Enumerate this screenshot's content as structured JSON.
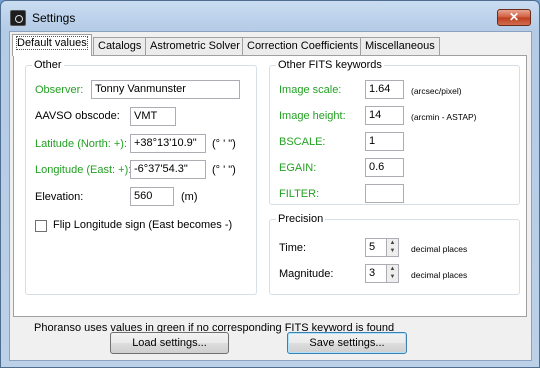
{
  "window": {
    "title": "Settings",
    "close_glyph": "✕"
  },
  "tabs": [
    "Default values",
    "Catalogs",
    "Astrometric Solver",
    "Correction Coefficients",
    "Miscellaneous"
  ],
  "other": {
    "legend": "Other",
    "observer_label": "Observer:",
    "observer_value": "Tonny Vanmunster",
    "obscode_label": "AAVSO obscode:",
    "obscode_value": "VMT",
    "lat_label": "Latitude (North: +):",
    "lat_value": "+38°13'10.9\"",
    "lat_unit": "(° ' \")",
    "lon_label": "Longitude (East: +):",
    "lon_value": "-6°37'54.3\"",
    "lon_unit": "(° ' \")",
    "elev_label": "Elevation:",
    "elev_value": "560",
    "elev_unit": "(m)",
    "flip_label": "Flip Longitude sign (East becomes -)",
    "flip_checked": false
  },
  "fits": {
    "legend": "Other FITS keywords",
    "scale_label": "Image scale:",
    "scale_value": "1.64",
    "scale_unit": "(arcsec/pixel)",
    "height_label": "Image height:",
    "height_value": "14",
    "height_unit": "(arcmin - ASTAP)",
    "bscale_label": "BSCALE:",
    "bscale_value": "1",
    "egain_label": "EGAIN:",
    "egain_value": "0.6",
    "filter_label": "FILTER:",
    "filter_value": ""
  },
  "precision": {
    "legend": "Precision",
    "time_label": "Time:",
    "time_value": "5",
    "mag_label": "Magnitude:",
    "mag_value": "3",
    "unit": "decimal places"
  },
  "note": "Phoranso uses values in green if no corresponding FITS keyword is found",
  "buttons": {
    "load": "Load settings...",
    "save": "Save settings..."
  },
  "colors": {
    "green_label": "#23a123",
    "close_button": "#c8492a"
  },
  "icons": {
    "app": "app-icon",
    "close": "close-icon",
    "spin_up": "▲",
    "spin_down": "▼"
  }
}
